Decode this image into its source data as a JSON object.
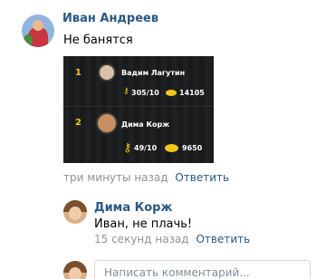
{
  "comment": {
    "author": "Иван Андреев",
    "text": "Не банятся",
    "time": "три минуты назад",
    "reply_label": "Ответить",
    "attachment": {
      "rows": [
        {
          "rank": "1",
          "name": "Вадим Лагутин",
          "keys": "305/10",
          "coins": "14105"
        },
        {
          "rank": "2",
          "name": "Дима Корж",
          "keys": "49/10",
          "coins": "9650"
        }
      ]
    }
  },
  "reply": {
    "author": "Дима Корж",
    "text": "Иван, не плачь!",
    "time": "15 секунд назад",
    "reply_label": "Ответить"
  },
  "composer": {
    "placeholder": "Написать комментарий..."
  }
}
